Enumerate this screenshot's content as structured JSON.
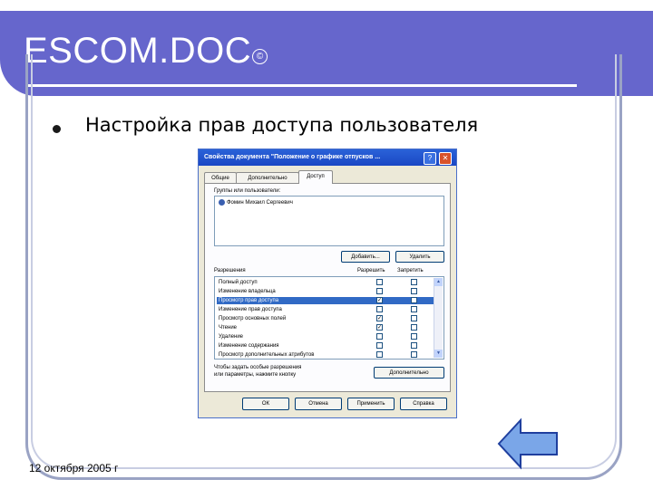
{
  "slide": {
    "title": "ESCOM.DOC",
    "copyright_symbol": "©",
    "bullet": "Настройка прав доступа пользователя",
    "date": "12 октября 2005 г",
    "title_bar_color": "#6666cc"
  },
  "dialog": {
    "title": "Свойства документа \"Положение о графике отпусков ...",
    "help_glyph": "?",
    "close_glyph": "✕",
    "tabs": [
      "Общие",
      "Дополнительно",
      "Доступ"
    ],
    "active_tab": "Доступ",
    "users_label": "Группы или пользователи:",
    "users": [
      "Фомин Михаил Сергеевич"
    ],
    "add_button": "Добавить...",
    "remove_button": "Удалить",
    "permissions_label": "Разрешения",
    "allow_header": "Разрешить",
    "deny_header": "Запретить",
    "permissions": [
      {
        "name": "Полный доступ",
        "allow": false,
        "deny": false,
        "selected": false
      },
      {
        "name": "Изменение владельца",
        "allow": false,
        "deny": false,
        "selected": false
      },
      {
        "name": "Просмотр прав доступа",
        "allow": true,
        "deny": false,
        "selected": true
      },
      {
        "name": "Изменение прав доступа",
        "allow": false,
        "deny": false,
        "selected": false
      },
      {
        "name": "Просмотр основных полей",
        "allow": true,
        "deny": false,
        "selected": false
      },
      {
        "name": "Чтение",
        "allow": true,
        "deny": false,
        "selected": false
      },
      {
        "name": "Удаление",
        "allow": false,
        "deny": false,
        "selected": false
      },
      {
        "name": "Изменение содержания",
        "allow": false,
        "deny": false,
        "selected": false
      },
      {
        "name": "Просмотр дополнительных атрибутов",
        "allow": false,
        "deny": false,
        "selected": false
      }
    ],
    "hint_line1": "Чтобы задать особые разрешения",
    "hint_line2": "или параметры, нажмите кнопку",
    "advanced_button": "Дополнительно",
    "ok_button": "ОК",
    "cancel_button": "Отмена",
    "apply_button": "Применить",
    "help_button": "Справка",
    "check_glyph": "✓"
  },
  "icons": {
    "back_arrow": "left-arrow-icon",
    "arrow_color": "#7aa6e8"
  }
}
